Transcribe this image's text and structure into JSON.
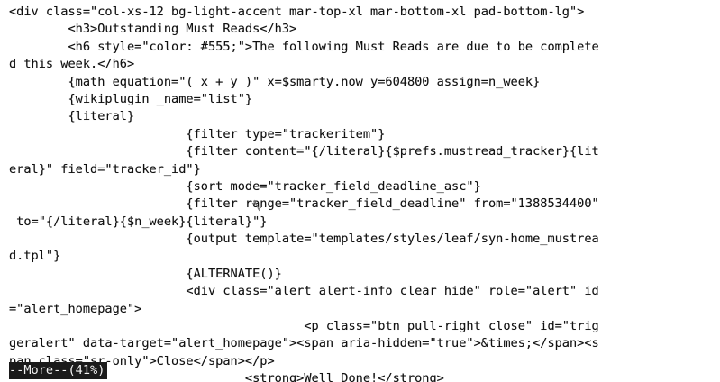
{
  "terminal": {
    "lines": [
      "<div class=\"col-xs-12 bg-light-accent mar-top-xl mar-bottom-xl pad-bottom-lg\">",
      "        <h3>Outstanding Must Reads</h3>",
      "        <h6 style=\"color: #555;\">The following Must Reads are due to be complete",
      "d this week.</h6>",
      "        {math equation=\"( x + y )\" x=$smarty.now y=604800 assign=n_week}",
      "        {wikiplugin _name=\"list\"}",
      "        {literal}",
      "                        {filter type=\"trackeritem\"}",
      "                        {filter content=\"{/literal}{$prefs.mustread_tracker}{lit",
      "eral}\" field=\"tracker_id\"}",
      "                        {sort mode=\"tracker_field_deadline_asc\"}",
      "                        {filter range=\"tracker_field_deadline\" from=\"1388534400\"",
      " to=\"{/literal}{$n_week}{literal}\"}",
      "                        {output template=\"templates/styles/leaf/syn-home_mustrea",
      "d.tpl\"}",
      "                        {ALTERNATE()}",
      "                        <div class=\"alert alert-info clear hide\" role=\"alert\" id",
      "=\"alert_homepage\">",
      "                                        <p class=\"btn pull-right close\" id=\"trig",
      "geralert\" data-target=\"alert_homepage\"><span aria-hidden=\"true\">&times;</span><s",
      "pan class=\"sr-only\">Close</span></p>",
      "                                <strong>Well Done!</strong>"
    ],
    "status": "--More--(41%)"
  },
  "colors": {
    "background": "#ffffff",
    "text": "#111111",
    "status_bg": "#1b1b1b",
    "status_text": "#f4f4f4"
  },
  "icons": {
    "cursor": "i-beam-cursor-icon"
  }
}
